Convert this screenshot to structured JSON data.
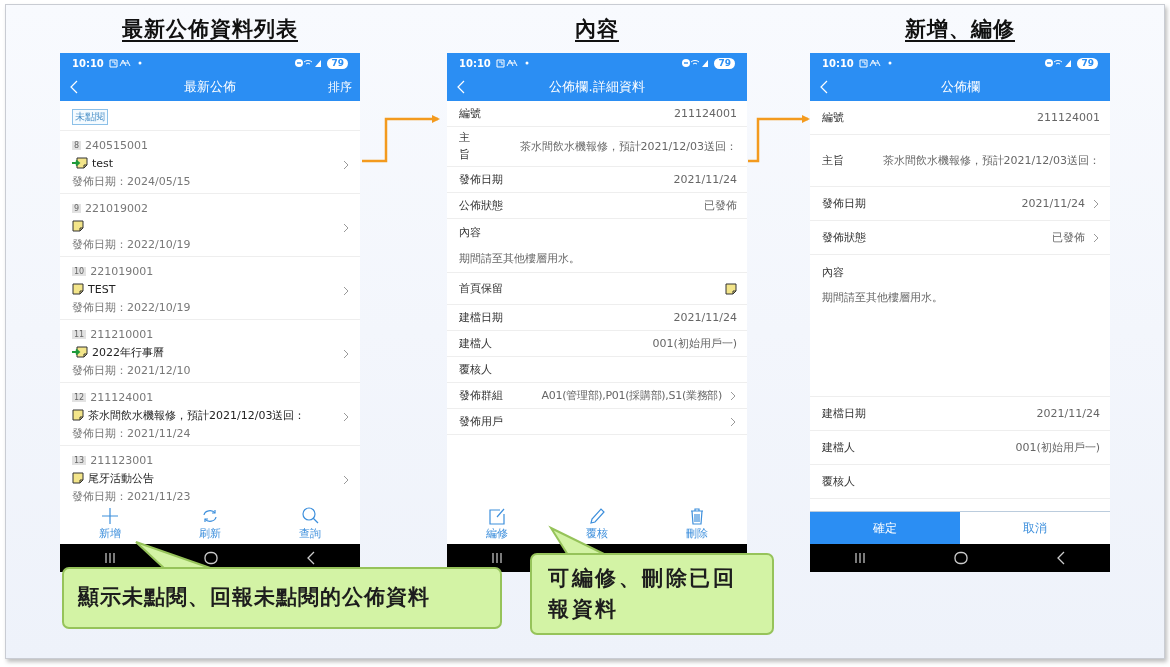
{
  "sections": [
    {
      "heading": "最新公佈資料列表",
      "phone": {
        "status": {
          "time": "10:10",
          "battery": "79"
        },
        "header": {
          "title": "最新公佈",
          "action": "排序"
        },
        "screen": {
          "kind": "list",
          "partial_badge": "未點閱",
          "items": [
            {
              "kind": "pinned",
              "index": "8",
              "number": "240515001",
              "title": "test",
              "date": "發佈日期：2024/05/15"
            },
            {
              "kind": "plain",
              "index": "9",
              "number": "221019002",
              "date": "發佈日期：2022/10/19"
            },
            {
              "kind": "plain",
              "index": "10",
              "number": "221019001",
              "title": "TEST",
              "date": "發佈日期：2022/10/19"
            },
            {
              "kind": "pinned",
              "index": "11",
              "number": "211210001",
              "title": "2022年行事曆",
              "date": "發佈日期：2021/12/10"
            },
            {
              "kind": "plain",
              "index": "12",
              "number": "211124001",
              "title": "茶水間飲水機報修，預計2021/12/03送回：",
              "date": "發佈日期：2021/11/24"
            },
            {
              "kind": "plain",
              "index": "13",
              "number": "211123001",
              "title": "尾牙活動公告",
              "date": "發佈日期：2021/11/23"
            }
          ],
          "toolbar": [
            {
              "label": "新增"
            },
            {
              "label": "刷新"
            },
            {
              "label": "查詢"
            }
          ]
        }
      }
    },
    {
      "heading": "內容",
      "phone": {
        "status": {
          "time": "10:10",
          "battery": "79"
        },
        "header": {
          "title": "公佈欄.詳細資料"
        },
        "screen": {
          "kind": "detail",
          "rows": [
            {
              "kind": "field",
              "label": "編號",
              "value": "211124001"
            },
            {
              "kind": "subject",
              "label": "主旨",
              "value": "茶水間飲水機報修，預計2021/12/03送回："
            },
            {
              "kind": "field",
              "label": "發佈日期",
              "value": "2021/11/24"
            },
            {
              "kind": "field",
              "label": "公佈狀態",
              "value": "已發佈"
            },
            {
              "kind": "heading",
              "label": "內容"
            },
            {
              "kind": "paragraph",
              "value": "期間請至其他樓層用水。"
            },
            {
              "kind": "note-icon",
              "label": "首頁保留"
            },
            {
              "kind": "field",
              "label": "建檔日期",
              "value": "2021/11/24"
            },
            {
              "kind": "field",
              "label": "建檔人",
              "value": "001(初始用戶一)"
            },
            {
              "kind": "field",
              "label": "覆核人"
            },
            {
              "kind": "field",
              "label": "發佈群組",
              "value": "A01(管理部),P01(採購部),S1(業務部)",
              "chevron": true
            },
            {
              "kind": "field",
              "label": "發佈用戶",
              "chevron": true
            }
          ],
          "toolbar": [
            {
              "label": "編修"
            },
            {
              "label": "覆核"
            },
            {
              "label": "刪除"
            }
          ]
        }
      }
    },
    {
      "heading": "新增、編修",
      "phone": {
        "status": {
          "time": "10:10",
          "battery": "79"
        },
        "header": {
          "title": "公佈欄"
        },
        "screen": {
          "kind": "form",
          "rows": [
            {
              "kind": "field",
              "label": "編號",
              "value": "211124001"
            },
            {
              "kind": "subject",
              "label": "主旨",
              "value": "茶水間飲水機報修，預計2021/12/03送回："
            },
            {
              "kind": "field",
              "label": "發佈日期",
              "value": "2021/11/24",
              "chevron": true
            },
            {
              "kind": "field",
              "label": "發佈狀態",
              "value": "已發佈",
              "chevron": true
            },
            {
              "kind": "content",
              "label": "內容",
              "value": "期間請至其他樓層用水。"
            },
            {
              "kind": "field",
              "label": "建檔日期",
              "value": "2021/11/24"
            },
            {
              "kind": "field",
              "label": "建檔人",
              "value": "001(初始用戶一)"
            },
            {
              "kind": "field",
              "label": "覆核人"
            }
          ],
          "buttons": [
            {
              "label": "確定",
              "primary": true
            },
            {
              "label": "取消",
              "primary": false
            }
          ]
        }
      }
    }
  ],
  "callouts": [
    "顯示未點閱、回報未點閱的公佈資料",
    "可編修、刪除已回報資料"
  ]
}
